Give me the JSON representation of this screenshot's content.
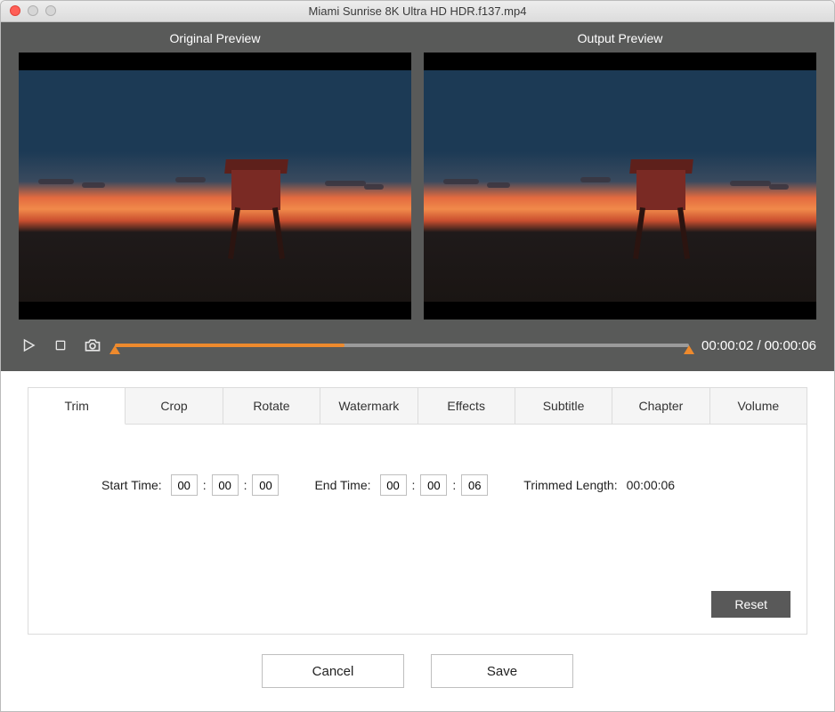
{
  "window": {
    "title": "Miami Sunrise 8K Ultra HD HDR.f137.mp4"
  },
  "previews": {
    "original_label": "Original Preview",
    "output_label": "Output  Preview"
  },
  "playback": {
    "current_time": "00:00:02",
    "total_time": "00:00:06",
    "progress_percent": 40
  },
  "tabs": [
    {
      "id": "trim",
      "label": "Trim",
      "active": true
    },
    {
      "id": "crop",
      "label": "Crop",
      "active": false
    },
    {
      "id": "rotate",
      "label": "Rotate",
      "active": false
    },
    {
      "id": "watermark",
      "label": "Watermark",
      "active": false
    },
    {
      "id": "effects",
      "label": "Effects",
      "active": false
    },
    {
      "id": "subtitle",
      "label": "Subtitle",
      "active": false
    },
    {
      "id": "chapter",
      "label": "Chapter",
      "active": false
    },
    {
      "id": "volume",
      "label": "Volume",
      "active": false
    }
  ],
  "trim": {
    "start_label": "Start Time:",
    "end_label": "End Time:",
    "length_label": "Trimmed Length:",
    "start": {
      "hh": "00",
      "mm": "00",
      "ss": "00"
    },
    "end": {
      "hh": "00",
      "mm": "00",
      "ss": "06"
    },
    "length_value": "00:00:06",
    "reset_label": "Reset"
  },
  "footer": {
    "cancel_label": "Cancel",
    "save_label": "Save"
  }
}
